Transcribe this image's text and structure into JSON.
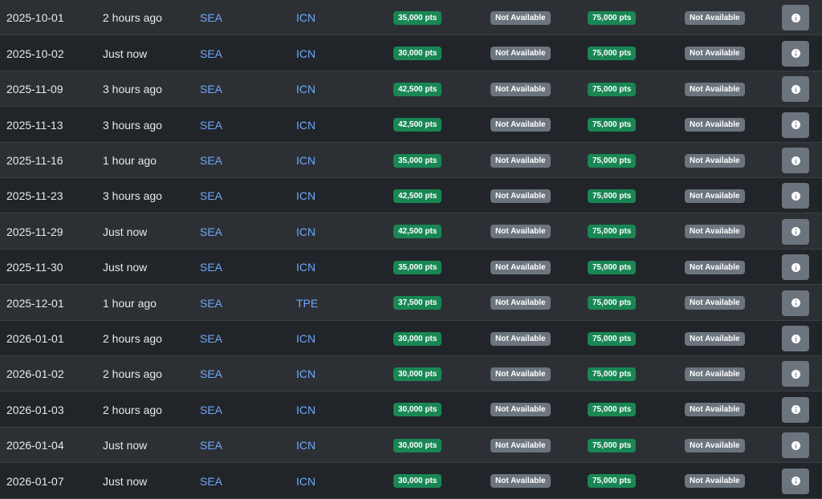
{
  "colors": {
    "row_odd": "#2c3034",
    "row_even": "#212529",
    "airport_link": "#6ea8fe",
    "badge_available": "#198754",
    "badge_unavailable": "#6c757d"
  },
  "rows": [
    {
      "date": "2025-10-01",
      "updated": "2 hours ago",
      "from": "SEA",
      "to": "ICN",
      "economy": "35,000 pts",
      "premium": "Not Available",
      "business": "75,000 pts",
      "first": "Not Available",
      "info_icon": "info-icon"
    },
    {
      "date": "2025-10-02",
      "updated": "Just now",
      "from": "SEA",
      "to": "ICN",
      "economy": "30,000 pts",
      "premium": "Not Available",
      "business": "75,000 pts",
      "first": "Not Available",
      "info_icon": "info-icon"
    },
    {
      "date": "2025-11-09",
      "updated": "3 hours ago",
      "from": "SEA",
      "to": "ICN",
      "economy": "42,500 pts",
      "premium": "Not Available",
      "business": "75,000 pts",
      "first": "Not Available",
      "info_icon": "info-icon"
    },
    {
      "date": "2025-11-13",
      "updated": "3 hours ago",
      "from": "SEA",
      "to": "ICN",
      "economy": "42,500 pts",
      "premium": "Not Available",
      "business": "75,000 pts",
      "first": "Not Available",
      "info_icon": "info-icon"
    },
    {
      "date": "2025-11-16",
      "updated": "1 hour ago",
      "from": "SEA",
      "to": "ICN",
      "economy": "35,000 pts",
      "premium": "Not Available",
      "business": "75,000 pts",
      "first": "Not Available",
      "info_icon": "info-icon"
    },
    {
      "date": "2025-11-23",
      "updated": "3 hours ago",
      "from": "SEA",
      "to": "ICN",
      "economy": "42,500 pts",
      "premium": "Not Available",
      "business": "75,000 pts",
      "first": "Not Available",
      "info_icon": "info-icon"
    },
    {
      "date": "2025-11-29",
      "updated": "Just now",
      "from": "SEA",
      "to": "ICN",
      "economy": "42,500 pts",
      "premium": "Not Available",
      "business": "75,000 pts",
      "first": "Not Available",
      "info_icon": "info-icon"
    },
    {
      "date": "2025-11-30",
      "updated": "Just now",
      "from": "SEA",
      "to": "ICN",
      "economy": "35,000 pts",
      "premium": "Not Available",
      "business": "75,000 pts",
      "first": "Not Available",
      "info_icon": "info-icon"
    },
    {
      "date": "2025-12-01",
      "updated": "1 hour ago",
      "from": "SEA",
      "to": "TPE",
      "economy": "37,500 pts",
      "premium": "Not Available",
      "business": "75,000 pts",
      "first": "Not Available",
      "info_icon": "info-icon"
    },
    {
      "date": "2026-01-01",
      "updated": "2 hours ago",
      "from": "SEA",
      "to": "ICN",
      "economy": "30,000 pts",
      "premium": "Not Available",
      "business": "75,000 pts",
      "first": "Not Available",
      "info_icon": "info-icon"
    },
    {
      "date": "2026-01-02",
      "updated": "2 hours ago",
      "from": "SEA",
      "to": "ICN",
      "economy": "30,000 pts",
      "premium": "Not Available",
      "business": "75,000 pts",
      "first": "Not Available",
      "info_icon": "info-icon"
    },
    {
      "date": "2026-01-03",
      "updated": "2 hours ago",
      "from": "SEA",
      "to": "ICN",
      "economy": "30,000 pts",
      "premium": "Not Available",
      "business": "75,000 pts",
      "first": "Not Available",
      "info_icon": "info-icon"
    },
    {
      "date": "2026-01-04",
      "updated": "Just now",
      "from": "SEA",
      "to": "ICN",
      "economy": "30,000 pts",
      "premium": "Not Available",
      "business": "75,000 pts",
      "first": "Not Available",
      "info_icon": "info-icon"
    },
    {
      "date": "2026-01-07",
      "updated": "Just now",
      "from": "SEA",
      "to": "ICN",
      "economy": "30,000 pts",
      "premium": "Not Available",
      "business": "75,000 pts",
      "first": "Not Available",
      "info_icon": "info-icon"
    }
  ]
}
